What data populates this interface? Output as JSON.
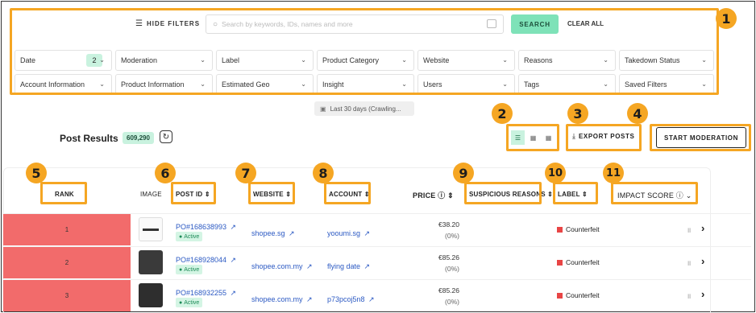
{
  "toolbar": {
    "hide_filters": "HIDE FILTERS",
    "search_placeholder": "Search by keywords, IDs, names and more",
    "search_button": "SEARCH",
    "clear_all": "CLEAR ALL"
  },
  "filters": {
    "date": "Date",
    "date_count": "2",
    "moderation": "Moderation",
    "label": "Label",
    "product_category": "Product Category",
    "website": "Website",
    "reasons": "Reasons",
    "takedown_status": "Takedown Status",
    "account_information": "Account Information",
    "product_information": "Product Information",
    "estimated_geo": "Estimated Geo",
    "insight": "Insight",
    "users": "Users",
    "tags": "Tags",
    "saved_filters": "Saved Filters"
  },
  "date_range": "Last 30 days (Crawling...",
  "results": {
    "title": "Post Results",
    "count": "609,290",
    "export_posts": "EXPORT POSTS",
    "start_moderation": "START MODERATION"
  },
  "columns": {
    "rank": "RANK",
    "image": "IMAGE",
    "post_id": "POST ID",
    "website": "WEBSITE",
    "account": "ACCOUNT",
    "price": "PRICE",
    "suspicious_reasons": "SUSPICIOUS REASONS",
    "label": "LABEL",
    "impact_score": "IMPACT SCORE"
  },
  "rows": [
    {
      "rank": "1",
      "post_id": "PO#168638993",
      "status": "Active",
      "website": "shopee.sg",
      "account": "yooumi.sg",
      "price": "€38.20",
      "pct": "(0%)",
      "label": "Counterfeit"
    },
    {
      "rank": "2",
      "post_id": "PO#168928044",
      "status": "Active",
      "website": "shopee.com.my",
      "account": "flying date",
      "price": "€85.26",
      "pct": "(0%)",
      "label": "Counterfeit"
    },
    {
      "rank": "3",
      "post_id": "PO#168932255",
      "status": "Active",
      "website": "shopee.com.my",
      "account": "p73pcoj5n8",
      "price": "€85.26",
      "pct": "(0%)",
      "label": "Counterfeit"
    }
  ],
  "annotations": [
    "1",
    "2",
    "3",
    "4",
    "5",
    "6",
    "7",
    "8",
    "9",
    "10",
    "11"
  ],
  "colors": {
    "accent_orange": "#f5a623",
    "rank_red": "#f26b6b",
    "search_green": "#7ee2b8",
    "link_blue": "#2b59c3"
  }
}
